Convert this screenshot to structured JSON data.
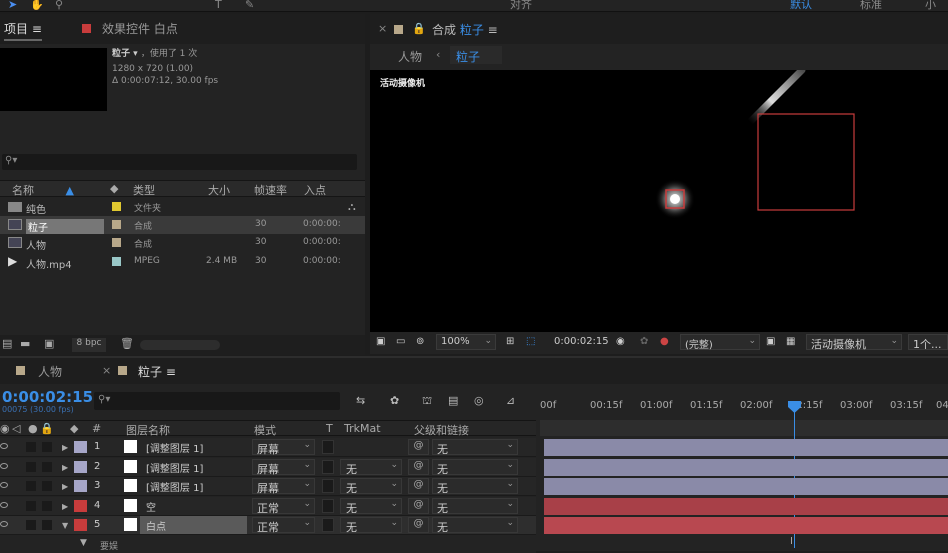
{
  "toolbar": {
    "align_label": "对齐",
    "workspace_default": "默认",
    "workspace_standard": "标准",
    "workspace_small": "小"
  },
  "project_panel": {
    "tab_project": "项目",
    "tab_effects": "效果控件 白点",
    "selected_name": "粒子",
    "used_text": "，使用了 1 次",
    "resolution": "1280 x 720 (1.00)",
    "duration": "Δ 0:00:07:12, 30.00 fps",
    "columns": [
      "名称",
      "类型",
      "大小",
      "帧速率",
      "入点"
    ],
    "items": [
      {
        "name": "纯色",
        "type": "文件夹",
        "size": "",
        "fps": "",
        "in": "",
        "color": "#e0c830"
      },
      {
        "name": "粒子",
        "type": "合成",
        "size": "",
        "fps": "30",
        "in": "0:00:00:",
        "color": "#b8a88a"
      },
      {
        "name": "人物",
        "type": "合成",
        "size": "",
        "fps": "30",
        "in": "0:00:00:",
        "color": "#b8a88a"
      },
      {
        "name": "人物.mp4",
        "type": "MPEG",
        "size": "2.4 MB",
        "fps": "30",
        "in": "0:00:00:",
        "color": "#9ac8c8"
      }
    ],
    "bpc": "8 bpc"
  },
  "comp_panel": {
    "tab_prefix": "合成",
    "tab_name": "粒子",
    "crumb_1": "人物",
    "crumb_2": "粒子",
    "camera_label": "活动摄像机",
    "zoom": "100%",
    "timecode": "0:00:02:15",
    "quality": "(完整)",
    "camera_select": "活动摄像机",
    "views": "1个..."
  },
  "timeline": {
    "tab_1": "人物",
    "tab_2": "粒子",
    "timecode": "0:00:02:15",
    "frame_info": "00075 (30.00 fps)",
    "col_num": "#",
    "col_name": "图层名称",
    "col_mode": "模式",
    "col_t": "T",
    "col_trkmat": "TrkMat",
    "col_parent": "父级和链接",
    "ruler": [
      "00f",
      "00:15f",
      "01:00f",
      "01:15f",
      "02:00f",
      "02:15f",
      "03:00f",
      "03:15f",
      "04:0"
    ],
    "layers": [
      {
        "num": "1",
        "name": "[调整图层 1]",
        "mode": "屏幕",
        "trkmat": "",
        "parent": "无",
        "color": "#a6a6c8",
        "bar": "#8a8aa8"
      },
      {
        "num": "2",
        "name": "[调整图层 1]",
        "mode": "屏幕",
        "trkmat": "无",
        "parent": "无",
        "color": "#a6a6c8",
        "bar": "#8a8aa8"
      },
      {
        "num": "3",
        "name": "[调整图层 1]",
        "mode": "屏幕",
        "trkmat": "无",
        "parent": "无",
        "color": "#a6a6c8",
        "bar": "#8a8aa8"
      },
      {
        "num": "4",
        "name": "空",
        "mode": "正常",
        "trkmat": "无",
        "parent": "无",
        "color": "#c83c3c",
        "bar": "#a84048"
      },
      {
        "num": "5",
        "name": "白点",
        "mode": "正常",
        "trkmat": "无",
        "parent": "无",
        "color": "#c83c3c",
        "bar": "#b84850"
      }
    ],
    "sub_label": "要娱"
  }
}
